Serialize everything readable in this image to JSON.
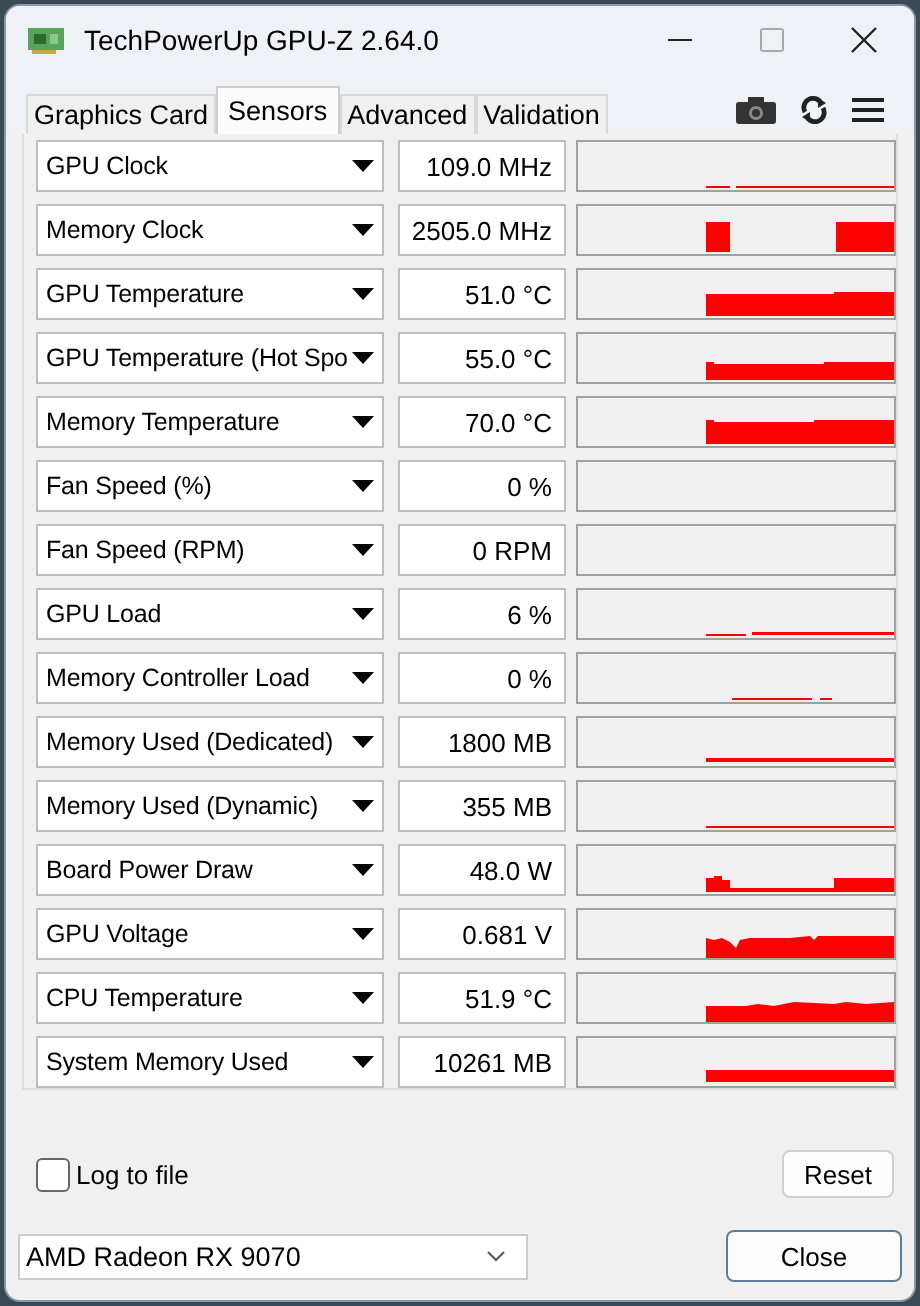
{
  "window": {
    "title": "TechPowerUp GPU-Z 2.64.0"
  },
  "tabs": [
    {
      "label": "Graphics Card",
      "selected": false
    },
    {
      "label": "Sensors",
      "selected": true
    },
    {
      "label": "Advanced",
      "selected": false
    },
    {
      "label": "Validation",
      "selected": false
    }
  ],
  "sensors": [
    {
      "name": "GPU Clock",
      "value": "109.0 MHz"
    },
    {
      "name": "Memory Clock",
      "value": "2505.0 MHz"
    },
    {
      "name": "GPU Temperature",
      "value": "51.0 °C"
    },
    {
      "name": "GPU Temperature (Hot Spo",
      "value": "55.0 °C"
    },
    {
      "name": "Memory Temperature",
      "value": "70.0 °C"
    },
    {
      "name": "Fan Speed (%)",
      "value": "0 %"
    },
    {
      "name": "Fan Speed (RPM)",
      "value": "0 RPM"
    },
    {
      "name": "GPU Load",
      "value": "6 %"
    },
    {
      "name": "Memory Controller Load",
      "value": "0 %"
    },
    {
      "name": "Memory Used (Dedicated)",
      "value": "1800 MB"
    },
    {
      "name": "Memory Used (Dynamic)",
      "value": "355 MB"
    },
    {
      "name": "Board Power Draw",
      "value": "48.0 W"
    },
    {
      "name": "GPU Voltage",
      "value": "0.681 V"
    },
    {
      "name": "CPU Temperature",
      "value": "51.9 °C"
    },
    {
      "name": "System Memory Used",
      "value": "10261 MB"
    }
  ],
  "log_to_file": {
    "label": "Log to file",
    "checked": false
  },
  "reset_button": "Reset",
  "gpu_select": {
    "value": "AMD Radeon RX 9070"
  },
  "close_button": "Close"
}
